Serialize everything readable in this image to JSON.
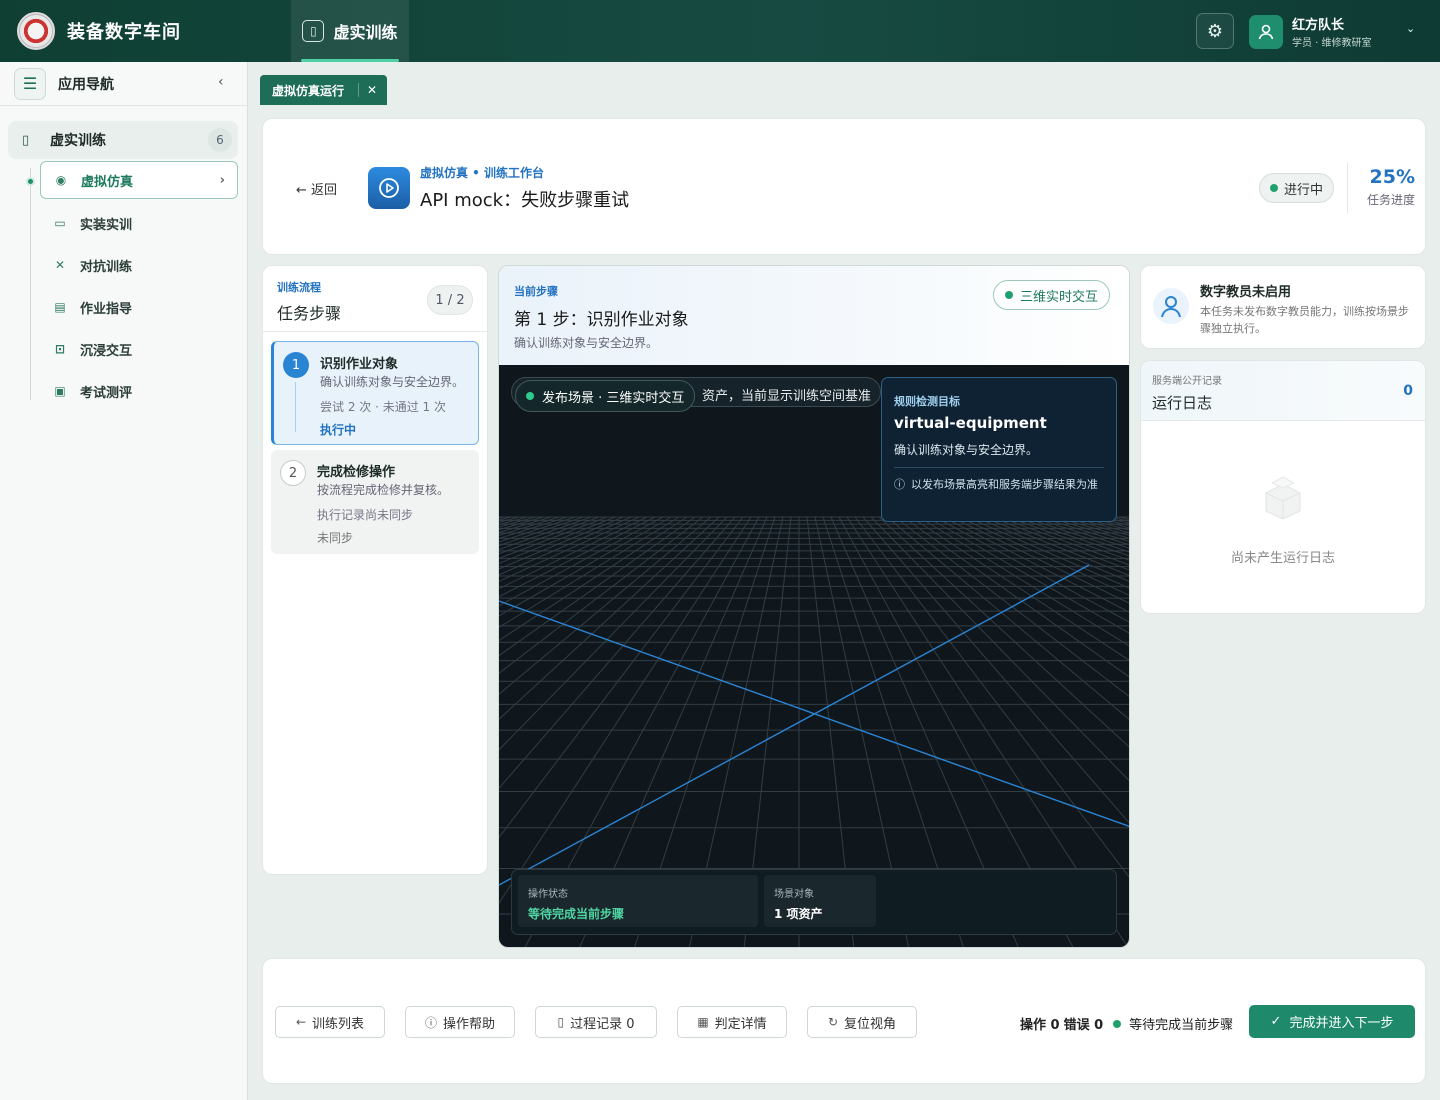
{
  "app": {
    "brand": "装备数字车间",
    "nav_tab": "虚实训练"
  },
  "user": {
    "name": "红方队长",
    "role": "学员 · 维修教研室"
  },
  "sidebar": {
    "title": "应用导航",
    "group": {
      "label": "虚实训练",
      "count": "6"
    },
    "items": [
      {
        "label": "虚拟仿真",
        "icon": "play-circle-icon"
      },
      {
        "label": "实装实训",
        "icon": "monitor-icon"
      },
      {
        "label": "对抗训练",
        "icon": "versus-icon"
      },
      {
        "label": "作业指导",
        "icon": "document-icon"
      },
      {
        "label": "沉浸交互",
        "icon": "vr-headset-icon"
      },
      {
        "label": "考试测评",
        "icon": "clipboard-icon"
      }
    ]
  },
  "tabs": [
    {
      "label": "虚拟仿真运行"
    }
  ],
  "header": {
    "back": "返回",
    "subtitle": "虚拟仿真 • 训练工作台",
    "title": "API mock：失败步骤重试",
    "status": "进行中",
    "progress": "25%",
    "progress_label": "任务进度",
    "progress_value": 0.25
  },
  "steps": {
    "label": "训练流程",
    "title": "任务步骤",
    "counter": "1 / 2",
    "list": [
      {
        "num": "1",
        "title": "识别作业对象",
        "desc": "确认训练对象与安全边界。",
        "meta": "尝试 2 次 · 未通过 1 次",
        "status": "执行中"
      },
      {
        "num": "2",
        "title": "完成检修操作",
        "desc": "按流程完成检修并复核。",
        "meta": "执行记录尚未同步",
        "status": "未同步"
      }
    ]
  },
  "current": {
    "label": "当前步骤",
    "title": "第 1 步：识别作业对象",
    "desc": "确认训练对象与安全边界。",
    "mode": "三维实时交互"
  },
  "scene": {
    "banner_pill": "发布场景 · 三维实时交互",
    "banner_tail": "资产，当前显示训练空间基准",
    "rule_label": "规则检测目标",
    "rule_title": "virtual-equipment",
    "rule_desc": "确认训练对象与安全边界。",
    "rule_note": "以发布场景高亮和服务端步骤结果为准",
    "status": [
      {
        "label": "操作状态",
        "value": "等待完成当前步骤"
      },
      {
        "label": "场景对象",
        "value": "1 项资产"
      }
    ]
  },
  "instructor": {
    "title": "数字教员未启用",
    "desc": "本任务未发布数字教员能力，训练按场景步骤独立执行。"
  },
  "log": {
    "label": "服务端公开记录",
    "title": "运行日志",
    "count": "0",
    "empty": "尚未产生运行日志"
  },
  "footer": {
    "buttons": [
      {
        "label": "训练列表",
        "icon": "arrow-left-icon"
      },
      {
        "label": "操作帮助",
        "icon": "info-icon"
      },
      {
        "label": "过程记录 0",
        "icon": "file-icon"
      },
      {
        "label": "判定详情",
        "icon": "calculator-icon"
      },
      {
        "label": "复位视角",
        "icon": "reset-icon"
      }
    ],
    "ops": "操作 0",
    "errors": "错误 0",
    "state": "等待完成当前步骤",
    "next": "完成并进入下一步"
  },
  "colors": {
    "primary": "#1e8a6b",
    "accent": "#2473c2",
    "topbar": "#0f3f33",
    "scene": "#10171c"
  }
}
